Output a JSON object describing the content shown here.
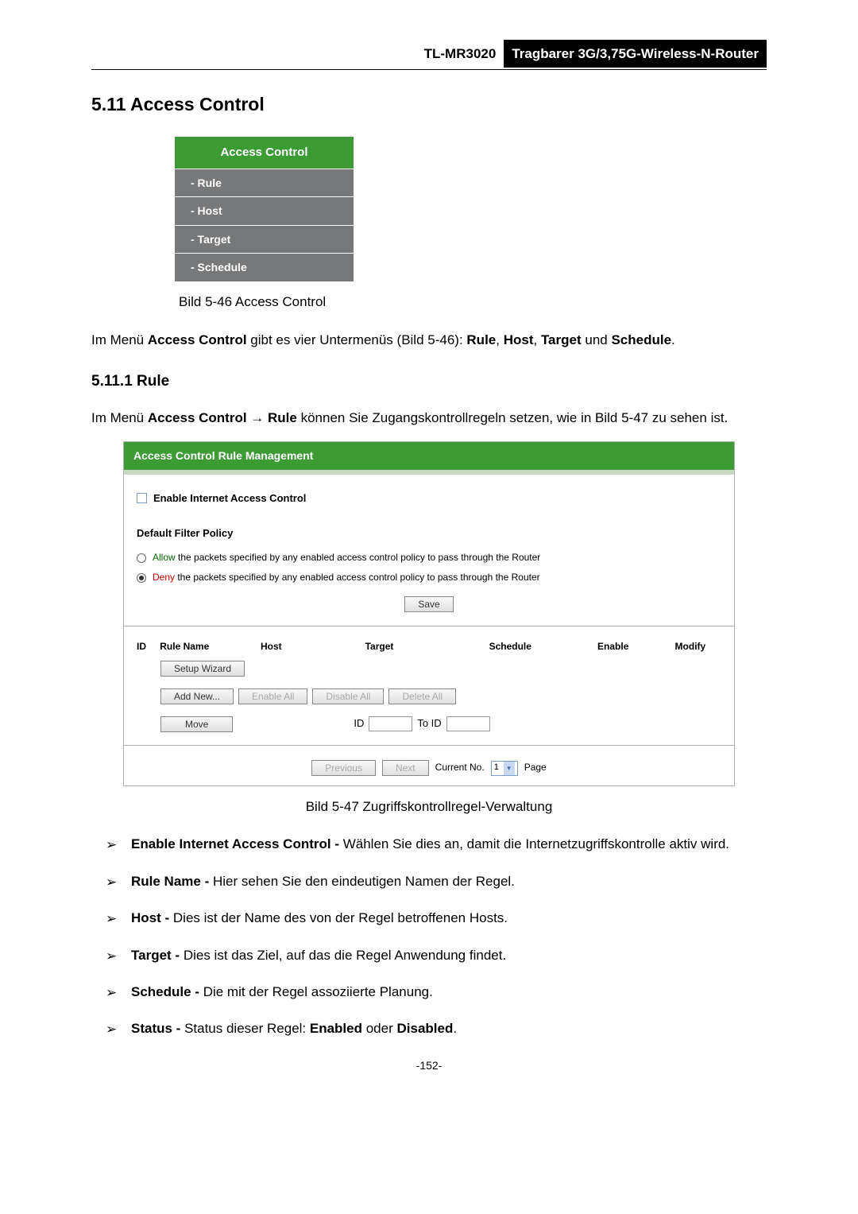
{
  "header": {
    "model": "TL-MR3020",
    "desc": "Tragbarer 3G/3,75G-Wireless-N-Router"
  },
  "section_title": "5.11  Access Control",
  "menu": {
    "title": "Access Control",
    "items": [
      "- Rule",
      "- Host",
      "- Target",
      "- Schedule"
    ]
  },
  "caption1": "Bild 5-46 Access Control",
  "para1_pre": "Im Menü ",
  "para1_b1": "Access Control",
  "para1_mid": " gibt es vier Untermenüs (Bild 5-46): ",
  "para1_b2": "Rule",
  "para1_c1": ", ",
  "para1_b3": "Host",
  "para1_c2": ", ",
  "para1_b4": "Target",
  "para1_c3": " und ",
  "para1_b5": "Schedule",
  "para1_end": ".",
  "subsection_title": "5.11.1  Rule",
  "para2_pre": "Im Menü ",
  "para2_b1": "Access Control → Rule",
  "para2_post": " können Sie Zugangskontrollregeln setzen, wie in Bild 5-47 zu sehen ist.",
  "screenshot": {
    "title": "Access Control Rule Management",
    "checkbox_label": "Enable Internet Access Control",
    "policy_title": "Default Filter Policy",
    "allow_label_kw": "Allow",
    "allow_label_rest": " the packets specified by any enabled access control policy to pass through the Router",
    "deny_label_kw": "Deny",
    "deny_label_rest": " the packets specified by any enabled access control policy to pass through the Router",
    "save": "Save",
    "cols": {
      "id": "ID",
      "rule_name": "Rule Name",
      "host": "Host",
      "target": "Target",
      "schedule": "Schedule",
      "enable": "Enable",
      "modify": "Modify"
    },
    "setup_wizard": "Setup Wizard",
    "add_new": "Add New...",
    "enable_all": "Enable All",
    "disable_all": "Disable All",
    "delete_all": "Delete All",
    "move": "Move",
    "id_label": "ID",
    "to_id_label": "To ID",
    "previous": "Previous",
    "next": "Next",
    "current_no": "Current No.",
    "page_val": "1",
    "page_label": "Page"
  },
  "caption2": "Bild 5-47 Zugriffskontrollregel-Verwaltung",
  "bullets": [
    {
      "b": "Enable Internet Access Control - ",
      "t": "Wählen Sie dies an, damit die Internetzugriffskontrolle aktiv wird."
    },
    {
      "b": "Rule Name - ",
      "t": "Hier sehen Sie den eindeutigen Namen der Regel."
    },
    {
      "b": "Host - ",
      "t": "Dies ist der Name des von der Regel betroffenen Hosts."
    },
    {
      "b": "Target - ",
      "t": "Dies ist das Ziel, auf das die Regel Anwendung findet."
    },
    {
      "b": "Schedule - ",
      "t": "Die mit der Regel assoziierte Planung."
    }
  ],
  "bullet6_b1": "Status - ",
  "bullet6_t1": "Status dieser Regel: ",
  "bullet6_b2": "Enabled",
  "bullet6_t2": " oder ",
  "bullet6_b3": "Disabled",
  "bullet6_t3": ".",
  "page_num": "-152-",
  "arrow": "➢"
}
